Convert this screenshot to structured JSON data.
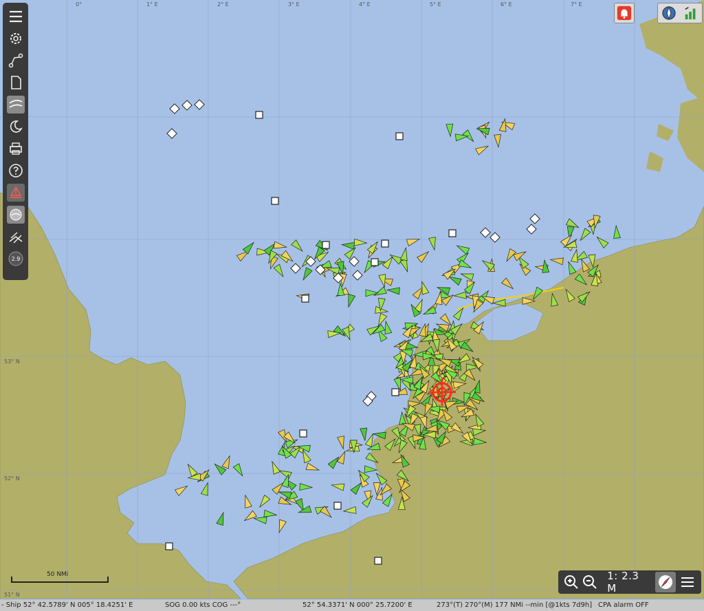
{
  "toolbar": {
    "items": [
      {
        "name": "menu-icon"
      },
      {
        "name": "settings-gear-icon"
      },
      {
        "name": "route-icon"
      },
      {
        "name": "document-icon"
      },
      {
        "name": "chart-layer-icon"
      },
      {
        "name": "night-mode-icon"
      },
      {
        "name": "print-icon"
      },
      {
        "name": "help-icon"
      },
      {
        "name": "sailboat-icon"
      },
      {
        "name": "tide-icon"
      },
      {
        "name": "track-icon"
      },
      {
        "name": "version-badge",
        "label": "2.9"
      }
    ]
  },
  "graticule": {
    "longitudes": [
      "0°",
      "1° E",
      "2° E",
      "3° E",
      "4° E",
      "5° E",
      "6° E",
      "7° E"
    ],
    "latitudes": [
      "53° N",
      "52° N",
      "51° N"
    ]
  },
  "scale_bar": {
    "label": "50 NMi"
  },
  "zoom": {
    "scale": "1: 2.3 M"
  },
  "status": {
    "ship": "- Ship 52° 42.5789' N   005° 18.4251' E",
    "sog": "SOG 0.00 kts  COG ---°",
    "cursor": "52° 54.3371' N   000° 25.7200' E",
    "bearing": "273°(T)  270°(M)  177 NMi  --min [@1kts 7d9h]",
    "cpa": "CPA alarm OFF"
  },
  "colors": {
    "sea": "#a7c1e6",
    "land": "#b2af69",
    "ais_green": "#6fe24a",
    "ais_yellow": "#f4d35e",
    "ownship": "#ff2a1a"
  }
}
